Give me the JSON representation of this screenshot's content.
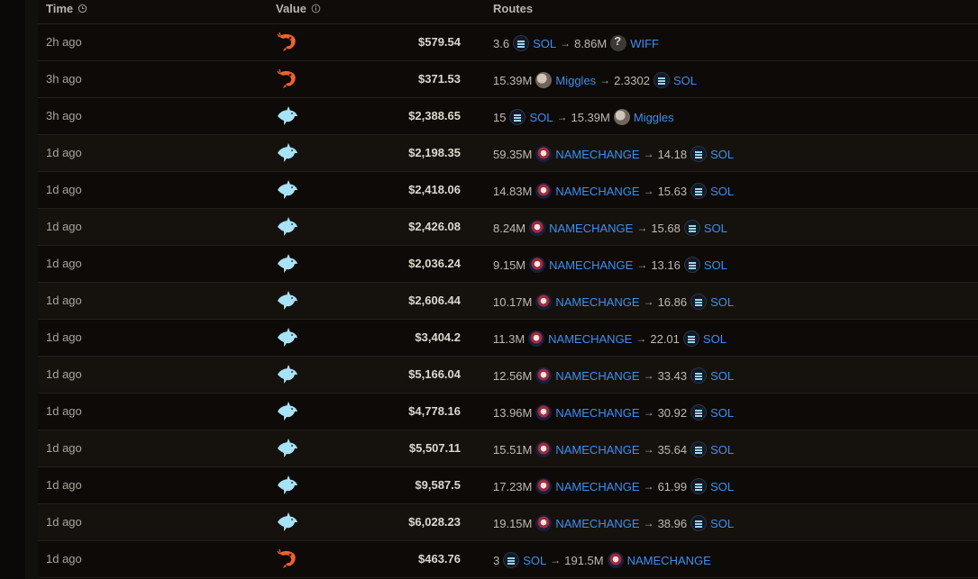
{
  "header": {
    "time_label": "Time",
    "value_label": "Value",
    "routes_label": "Routes"
  },
  "rows": [
    {
      "time": "2h ago",
      "value": "$579.54",
      "side": "shrimp",
      "route": [
        {
          "amount": "3.6",
          "token": "SOL",
          "icon": "sol"
        },
        {
          "amount": "8.86M",
          "token": "WIFF",
          "icon": "wiff"
        }
      ]
    },
    {
      "time": "3h ago",
      "value": "$371.53",
      "side": "shrimp",
      "route": [
        {
          "amount": "15.39M",
          "token": "Miggles",
          "icon": "miggles"
        },
        {
          "amount": "2.3302",
          "token": "SOL",
          "icon": "sol"
        }
      ]
    },
    {
      "time": "3h ago",
      "value": "$2,388.65",
      "side": "dolphin",
      "route": [
        {
          "amount": "15",
          "token": "SOL",
          "icon": "sol"
        },
        {
          "amount": "15.39M",
          "token": "Miggles",
          "icon": "miggles"
        }
      ]
    },
    {
      "time": "1d ago",
      "value": "$2,198.35",
      "side": "dolphin",
      "route": [
        {
          "amount": "59.35M",
          "token": "NAMECHANGE",
          "icon": "namechange"
        },
        {
          "amount": "14.18",
          "token": "SOL",
          "icon": "sol"
        }
      ]
    },
    {
      "time": "1d ago",
      "value": "$2,418.06",
      "side": "dolphin",
      "route": [
        {
          "amount": "14.83M",
          "token": "NAMECHANGE",
          "icon": "namechange"
        },
        {
          "amount": "15.63",
          "token": "SOL",
          "icon": "sol"
        }
      ]
    },
    {
      "time": "1d ago",
      "value": "$2,426.08",
      "side": "dolphin",
      "route": [
        {
          "amount": "8.24M",
          "token": "NAMECHANGE",
          "icon": "namechange"
        },
        {
          "amount": "15.68",
          "token": "SOL",
          "icon": "sol"
        }
      ]
    },
    {
      "time": "1d ago",
      "value": "$2,036.24",
      "side": "dolphin",
      "route": [
        {
          "amount": "9.15M",
          "token": "NAMECHANGE",
          "icon": "namechange"
        },
        {
          "amount": "13.16",
          "token": "SOL",
          "icon": "sol"
        }
      ]
    },
    {
      "time": "1d ago",
      "value": "$2,606.44",
      "side": "dolphin",
      "route": [
        {
          "amount": "10.17M",
          "token": "NAMECHANGE",
          "icon": "namechange"
        },
        {
          "amount": "16.86",
          "token": "SOL",
          "icon": "sol"
        }
      ]
    },
    {
      "time": "1d ago",
      "value": "$3,404.2",
      "side": "dolphin",
      "route": [
        {
          "amount": "11.3M",
          "token": "NAMECHANGE",
          "icon": "namechange"
        },
        {
          "amount": "22.01",
          "token": "SOL",
          "icon": "sol"
        }
      ]
    },
    {
      "time": "1d ago",
      "value": "$5,166.04",
      "side": "dolphin",
      "route": [
        {
          "amount": "12.56M",
          "token": "NAMECHANGE",
          "icon": "namechange"
        },
        {
          "amount": "33.43",
          "token": "SOL",
          "icon": "sol"
        }
      ]
    },
    {
      "time": "1d ago",
      "value": "$4,778.16",
      "side": "dolphin",
      "route": [
        {
          "amount": "13.96M",
          "token": "NAMECHANGE",
          "icon": "namechange"
        },
        {
          "amount": "30.92",
          "token": "SOL",
          "icon": "sol"
        }
      ]
    },
    {
      "time": "1d ago",
      "value": "$5,507.11",
      "side": "dolphin",
      "route": [
        {
          "amount": "15.51M",
          "token": "NAMECHANGE",
          "icon": "namechange"
        },
        {
          "amount": "35.64",
          "token": "SOL",
          "icon": "sol"
        }
      ]
    },
    {
      "time": "1d ago",
      "value": "$9,587.5",
      "side": "dolphin",
      "route": [
        {
          "amount": "17.23M",
          "token": "NAMECHANGE",
          "icon": "namechange"
        },
        {
          "amount": "61.99",
          "token": "SOL",
          "icon": "sol"
        }
      ]
    },
    {
      "time": "1d ago",
      "value": "$6,028.23",
      "side": "dolphin",
      "route": [
        {
          "amount": "19.15M",
          "token": "NAMECHANGE",
          "icon": "namechange"
        },
        {
          "amount": "38.96",
          "token": "SOL",
          "icon": "sol"
        }
      ]
    },
    {
      "time": "1d ago",
      "value": "$463.76",
      "side": "shrimp",
      "route": [
        {
          "amount": "3",
          "token": "SOL",
          "icon": "sol"
        },
        {
          "amount": "191.5M",
          "token": "NAMECHANGE",
          "icon": "namechange"
        }
      ]
    }
  ],
  "colors": {
    "shrimp": "#f0622c",
    "dolphin": "#a8e2f6",
    "token_link": "#3d8ff0"
  }
}
